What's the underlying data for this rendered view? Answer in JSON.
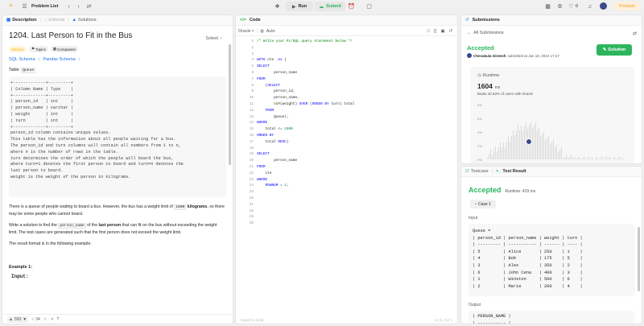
{
  "topbar": {
    "problem_list": "Problem List",
    "run": "Run",
    "submit": "Submit",
    "count": "0",
    "premium": "Premium"
  },
  "left": {
    "tab_description": "Description",
    "tab_editorial": "Editorial",
    "tab_solutions": "Solutions",
    "title": "1204. Last Person to Fit in the Bus",
    "solved": "Solved",
    "tags": [
      "Medium",
      "Topics",
      "Companies"
    ],
    "schema_links": [
      "SQL Schema",
      "Pandas Schema"
    ],
    "table_label": "Table:",
    "table_name": "Queue",
    "schema_block": "+-------------+---------+\n| Column Name | Type    |\n+-------------+---------+\n| person_id   | int     |\n| person_name | varchar |\n| weight      | int     |\n| turn        | int     |\n+-------------+---------+\nperson_id column contains unique values.\nThis table has the information about all people waiting for a bus.\nThe person_id and turn columns will contain all numbers from 1 to n,\nwhere n is the number of rows in the table.\nturn determines the order of which the people will board the bus,\nwhere turn=1 denotes the first person to board and turn=n denotes the\nlast person to board.\nweight is the weight of the person in kilograms.",
    "p1_a": "There is a queue of people waiting to board a bus. However, the bus has a weight limit of ",
    "p1_code": "1000",
    "p1_b": " kilograms",
    "p1_c": ", so there may be some people who cannot board.",
    "p2_a": "Write a solution to find the ",
    "p2_code": "person_name",
    "p2_b": " of the ",
    "p2_bold": "last person",
    "p2_c": " that can fit on the bus without exceeding the weight limit. The test cases are generated such that the first person does not exceed the weight limit.",
    "p3": "The result format is in the following example.",
    "example": "Example 1:",
    "input": "Input:",
    "likes": "593",
    "comments": "34"
  },
  "editor": {
    "title": "Code",
    "language": "Oracle",
    "auto": "Auto",
    "lines": [
      "/* Write your PL/SQL query statement below */",
      "",
      "",
      "WITH cte  As (",
      "SELECT",
      "        person_name",
      "FROM",
      "    (SELECT",
      "        person_id,",
      "        person_name,",
      "        SUM(weight) OVER (ORDER BY turn) total",
      "    FROM",
      "        Queue);",
      "WHERE",
      "    total <= 1000",
      "ORDER BY",
      "    total DESC)",
      "",
      "SELECT",
      "        person_name",
      "FROM",
      "    cte",
      "WHERE",
      "    ROWNUM = 1;",
      "",
      "",
      "",
      "",
      "",
      ""
    ],
    "saved": "Saved to local",
    "cursor": "Ln 1, Col 1"
  },
  "submissions": {
    "title": "Submissions",
    "back": "All Submissions",
    "status": "Accepted",
    "user": "Chevakula Gireesh",
    "submitted": "submitted at Jan 18, 2024 17:27",
    "solution_btn": "Solution",
    "runtime_label": "Runtime",
    "runtime_value": "1604",
    "runtime_unit": "ms",
    "beats": "Beats 42.63% of users with Oracle",
    "axis": [
      "8%",
      "6%",
      "4%",
      "2%",
      "0%"
    ]
  },
  "testresult": {
    "tab_testcase": "Testcase",
    "tab_result": "Test Result",
    "status": "Accepted",
    "runtime": "Runtime: 429 ms",
    "case": "Case 1",
    "input_label": "Input",
    "output_label": "Output",
    "input_block": "Queue =\n| person_id | person_name | weight | turn |\n| --------- | ----------- | ------ | ---- |\n| 5         | Alice       | 250    | 1    |\n| 4         | Bob         | 175    | 5    |\n| 3         | Alex        | 350    | 2    |\n| 6         | John Cena   | 400    | 3    |\n| 1         | Winston     | 500    | 6    |\n| 2         | Marie       | 200    | 4    |",
    "output_block": "| PERSON_NAME |\n| ----------- |"
  }
}
